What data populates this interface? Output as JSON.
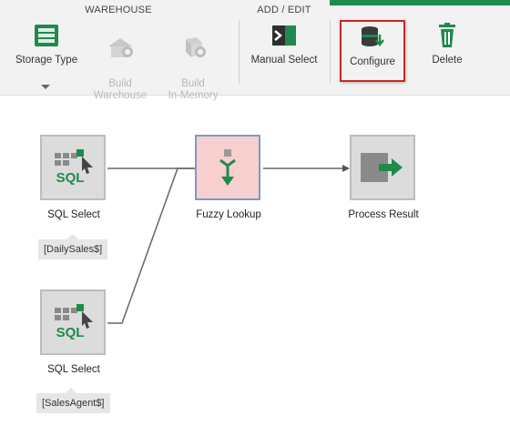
{
  "ribbon": {
    "groups": {
      "warehouse": "WAREHOUSE",
      "add_edit": "ADD / EDIT"
    },
    "buttons": {
      "storage_type": "Storage Type",
      "build_warehouse": "Build\nWarehouse",
      "build_inmemory": "Build\nIn-Memory",
      "manual_select": "Manual Select",
      "configure": "Configure",
      "delete": "Delete"
    }
  },
  "colors": {
    "accent": "#1f8a4c",
    "selected_border": "#c62828",
    "active_node": "#f8cfcf"
  },
  "flow": {
    "nodes": {
      "sql1": {
        "label": "SQL Select",
        "tag": "[DailySales$]",
        "icon": "sql-select-icon"
      },
      "fuzzy": {
        "label": "Fuzzy Lookup",
        "icon": "fuzzy-lookup-icon"
      },
      "result": {
        "label": "Process Result",
        "icon": "process-result-icon"
      },
      "sql2": {
        "label": "SQL Select",
        "tag": "[SalesAgent$]",
        "icon": "sql-select-icon"
      }
    }
  }
}
